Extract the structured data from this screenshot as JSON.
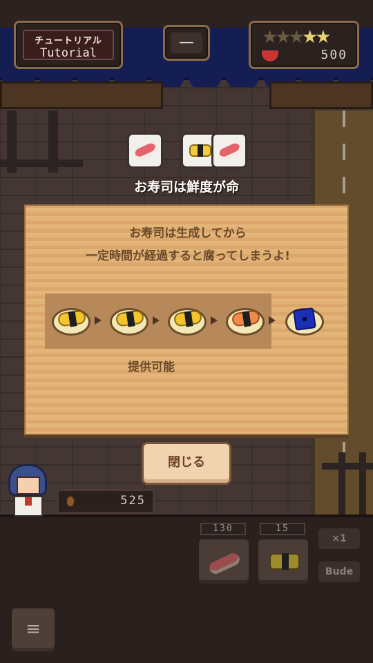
{
  "hud": {
    "tutorial_jp": "チュートリアル",
    "tutorial_en": "Tutorial",
    "minus_label": "—",
    "stars_filled": 2,
    "stars_total": 5,
    "top_money": "500"
  },
  "orders": [
    {
      "icon": "tuna-nigiri-icon"
    },
    {
      "icon": "tamago-nigiri-icon"
    },
    {
      "icon": "tuna-nigiri-icon"
    }
  ],
  "dialog": {
    "title": "お寿司は鮮度が命",
    "line1": "お寿司は生成してから",
    "line2": "一定時間が経過すると腐ってしまうよ!",
    "stages": [
      {
        "icon": "fresh-tamago-sushi-icon",
        "state": "fresh"
      },
      {
        "icon": "fresh-tamago-sushi-icon",
        "state": "fresh"
      },
      {
        "icon": "fresh-tamago-sushi-icon",
        "state": "fresh"
      },
      {
        "icon": "spoiling-sushi-icon",
        "state": "spoiling"
      },
      {
        "icon": "rotten-sushi-icon",
        "state": "rotten"
      }
    ],
    "servable_label": "提供可能",
    "close_label": "閉じる"
  },
  "player": {
    "money": "525"
  },
  "tray": {
    "slot1_count": "130",
    "slot2_count": "15",
    "speed_label": "×1",
    "side_label": "Bude"
  },
  "colors": {
    "awning": "#1c2a73",
    "dialog_wood": "#e0b073",
    "dialog_text": "#6b4a2a",
    "close_button": "#f1d3b0"
  }
}
